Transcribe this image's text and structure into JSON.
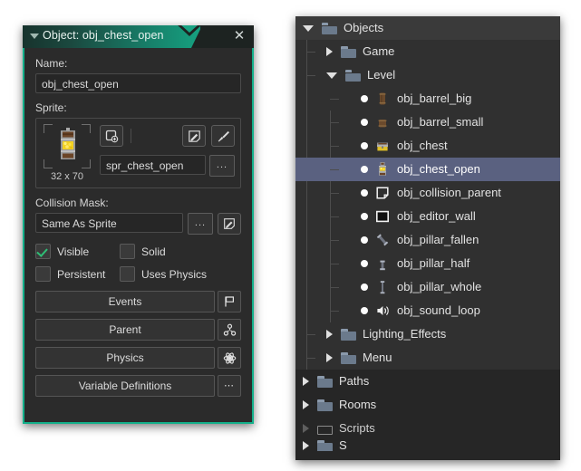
{
  "object_window": {
    "title": "Object: obj_chest_open",
    "collapse_icon": "collapse-triangle-icon",
    "close_icon": "close-icon",
    "name_label": "Name:",
    "name_value": "obj_chest_open",
    "sprite_label": "Sprite:",
    "sprite_dimensions": "32 x 70",
    "sprite_name": "spr_chest_open",
    "sprite_name_menu": "...",
    "new_sprite_icon": "new-sprite-icon",
    "edit_sprite_icon": "edit-sprite-icon",
    "paint_sprite_icon": "paintbrush-icon",
    "collision_mask_label": "Collision Mask:",
    "collision_mask_value": "Same As Sprite",
    "collision_mask_menu": "...",
    "collision_mask_edit_icon": "edit-mask-icon",
    "checkboxes": [
      {
        "label": "Visible",
        "checked": true
      },
      {
        "label": "Solid",
        "checked": false
      },
      {
        "label": "Persistent",
        "checked": false
      },
      {
        "label": "Uses Physics",
        "checked": false
      }
    ],
    "buttons": [
      {
        "label": "Events",
        "icon": "flag-icon"
      },
      {
        "label": "Parent",
        "icon": "hierarchy-icon"
      },
      {
        "label": "Physics",
        "icon": "atom-icon"
      },
      {
        "label": "Variable Definitions",
        "icon": "ellipsis-icon"
      }
    ],
    "accent_color": "#13b08a",
    "title_gradient_start": "#17332d",
    "title_gradient_end": "#16a180"
  },
  "tree": {
    "selection_color": "#5a6180",
    "rows": [
      {
        "label": "Objects",
        "depth": 0,
        "type": "folder",
        "state": "open",
        "icon": "folder-open-icon"
      },
      {
        "label": "Game",
        "depth": 1,
        "type": "folder",
        "state": "closed",
        "icon": "folder-closed-icon"
      },
      {
        "label": "Level",
        "depth": 1,
        "type": "folder",
        "state": "open",
        "icon": "folder-open-icon"
      },
      {
        "label": "obj_barrel_big",
        "depth": 2,
        "type": "leaf",
        "icon": "barrel-big-icon"
      },
      {
        "label": "obj_barrel_small",
        "depth": 2,
        "type": "leaf",
        "icon": "barrel-small-icon"
      },
      {
        "label": "obj_chest",
        "depth": 2,
        "type": "leaf",
        "icon": "chest-closed-icon"
      },
      {
        "label": "obj_chest_open",
        "depth": 2,
        "type": "leaf",
        "icon": "chest-open-icon",
        "selected": true
      },
      {
        "label": "obj_collision_parent",
        "depth": 2,
        "type": "leaf",
        "icon": "collision-parent-icon"
      },
      {
        "label": "obj_editor_wall",
        "depth": 2,
        "type": "leaf",
        "icon": "editor-wall-icon"
      },
      {
        "label": "obj_pillar_fallen",
        "depth": 2,
        "type": "leaf",
        "icon": "pillar-fallen-icon"
      },
      {
        "label": "obj_pillar_half",
        "depth": 2,
        "type": "leaf",
        "icon": "pillar-half-icon"
      },
      {
        "label": "obj_pillar_whole",
        "depth": 2,
        "type": "leaf",
        "icon": "pillar-whole-icon"
      },
      {
        "label": "obj_sound_loop",
        "depth": 2,
        "type": "leaf",
        "icon": "speaker-icon"
      },
      {
        "label": "Lighting_Effects",
        "depth": 1,
        "type": "folder",
        "state": "closed",
        "icon": "folder-closed-icon"
      },
      {
        "label": "Menu",
        "depth": 1,
        "type": "folder",
        "state": "closed",
        "icon": "folder-closed-icon"
      },
      {
        "label": "Paths",
        "depth": 0,
        "type": "folder",
        "state": "closed",
        "icon": "folder-closed-icon"
      },
      {
        "label": "Rooms",
        "depth": 0,
        "type": "folder",
        "state": "closed",
        "icon": "folder-closed-icon"
      },
      {
        "label": "Scripts",
        "depth": 0,
        "type": "folder",
        "state": "closed",
        "icon": "folder-empty-icon",
        "dim": true
      },
      {
        "label": "S",
        "depth": 0,
        "type": "folder",
        "state": "closed",
        "icon": "folder-closed-icon",
        "clipped": true
      }
    ]
  }
}
